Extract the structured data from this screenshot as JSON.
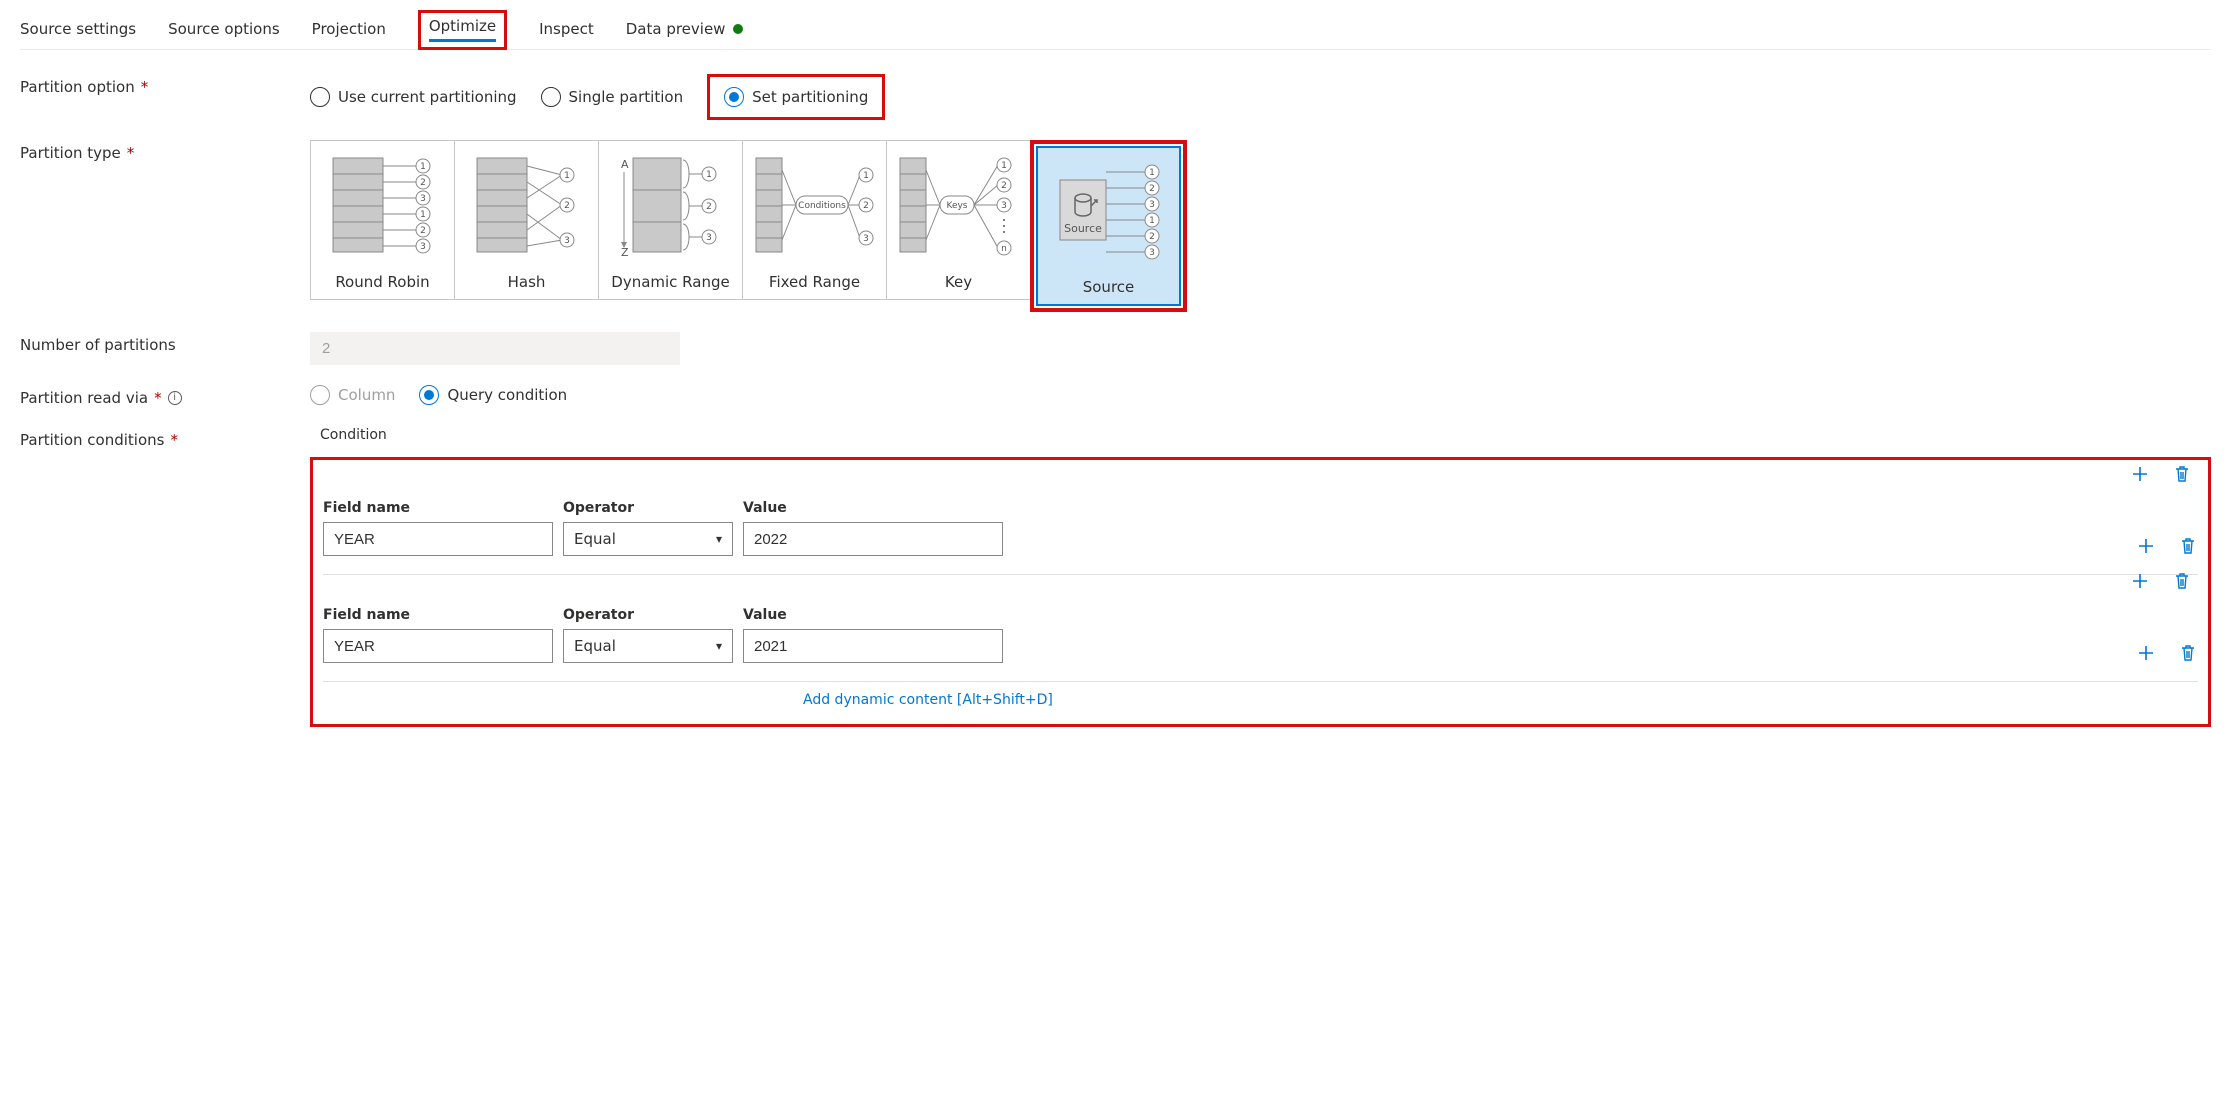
{
  "tabs": {
    "source_settings": "Source settings",
    "source_options": "Source options",
    "projection": "Projection",
    "optimize": "Optimize",
    "inspect": "Inspect",
    "data_preview": "Data preview"
  },
  "labels": {
    "partition_option": "Partition option",
    "partition_type": "Partition type",
    "num_partitions": "Number of partitions",
    "partition_read_via": "Partition read via",
    "partition_conditions": "Partition conditions"
  },
  "partition_option": {
    "use_current": "Use current partitioning",
    "single": "Single partition",
    "set": "Set partitioning"
  },
  "partition_types": {
    "round_robin": "Round Robin",
    "hash": "Hash",
    "dynamic_range": "Dynamic Range",
    "fixed_range": "Fixed Range",
    "key": "Key",
    "source": "Source"
  },
  "num_partitions_value": "2",
  "read_via": {
    "column": "Column",
    "query": "Query condition"
  },
  "conditions": {
    "heading": "Condition",
    "headers": {
      "field": "Field name",
      "operator": "Operator",
      "value": "Value"
    },
    "rows": [
      {
        "field": "YEAR",
        "operator": "Equal",
        "value": "2022"
      },
      {
        "field": "YEAR",
        "operator": "Equal",
        "value": "2021"
      }
    ],
    "dynamic_link": "Add dynamic content [Alt+Shift+D]"
  },
  "svg_text": {
    "conditions": "Conditions",
    "keys": "Keys",
    "source": "Source",
    "a": "A",
    "z": "Z",
    "n": "n"
  }
}
